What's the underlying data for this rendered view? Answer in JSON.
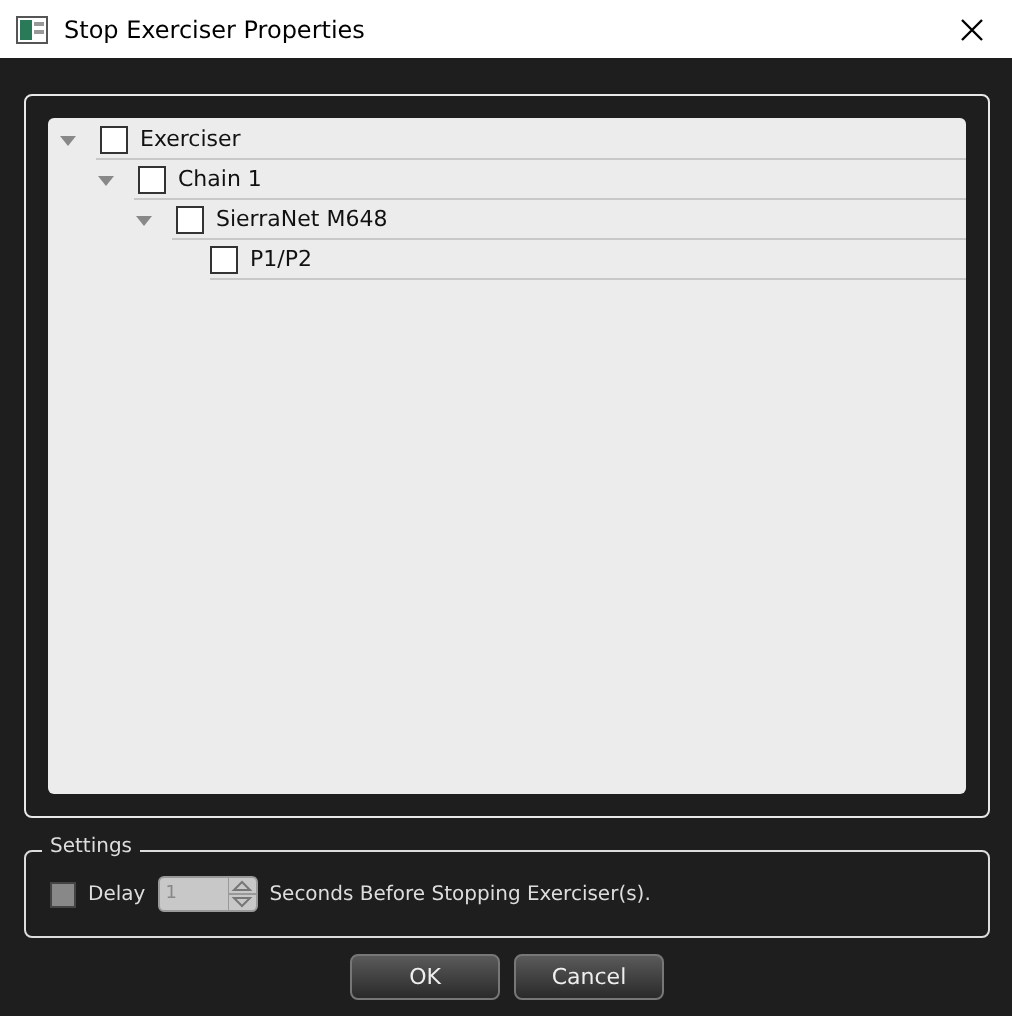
{
  "window": {
    "title": "Stop Exerciser Properties"
  },
  "tree": [
    {
      "label": "Exerciser",
      "checked": false,
      "expanded": true,
      "children": [
        {
          "label": "Chain 1",
          "checked": false,
          "expanded": true,
          "children": [
            {
              "label": "SierraNet M648",
              "checked": false,
              "expanded": true,
              "children": [
                {
                  "label": "P1/P2",
                  "checked": false
                }
              ]
            }
          ]
        }
      ]
    }
  ],
  "settings": {
    "title": "Settings",
    "delay": {
      "label": "Delay",
      "checked": false
    },
    "spinner": {
      "value": "1",
      "disabled": true
    },
    "suffix": "Seconds Before Stopping Exerciser(s)."
  },
  "buttons": [
    "OK",
    "Cancel"
  ]
}
